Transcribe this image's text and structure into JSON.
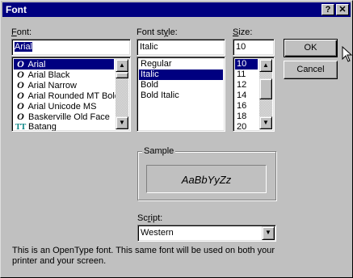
{
  "title": "Font",
  "title_buttons": {
    "help": "?",
    "close": "✕"
  },
  "font": {
    "label": "Font:",
    "value": "Arial",
    "items": [
      {
        "icon": "O",
        "name": "Arial",
        "selected": true
      },
      {
        "icon": "O",
        "name": "Arial Black"
      },
      {
        "icon": "O",
        "name": "Arial Narrow"
      },
      {
        "icon": "O",
        "name": "Arial Rounded MT Bold"
      },
      {
        "icon": "O",
        "name": "Arial Unicode MS"
      },
      {
        "icon": "O",
        "name": "Baskerville Old Face"
      },
      {
        "icon": "TT",
        "name": "Batang"
      }
    ]
  },
  "style": {
    "label": "Font style:",
    "value": "Italic",
    "items": [
      {
        "name": "Regular"
      },
      {
        "name": "Italic",
        "selected": true
      },
      {
        "name": "Bold"
      },
      {
        "name": "Bold Italic"
      }
    ]
  },
  "size": {
    "label": "Size:",
    "value": "10",
    "items": [
      "10",
      "11",
      "12",
      "14",
      "16",
      "18",
      "20"
    ]
  },
  "buttons": {
    "ok": "OK",
    "cancel": "Cancel"
  },
  "sample": {
    "label": "Sample",
    "text": "AaBbYyZz"
  },
  "script": {
    "label": "Script:",
    "value": "Western"
  },
  "description": "This is an OpenType font. This same font will be used on both your printer and your screen.",
  "colors": {
    "titlebar": "#000080",
    "face": "#c0c0c0",
    "selection": "#000080"
  }
}
